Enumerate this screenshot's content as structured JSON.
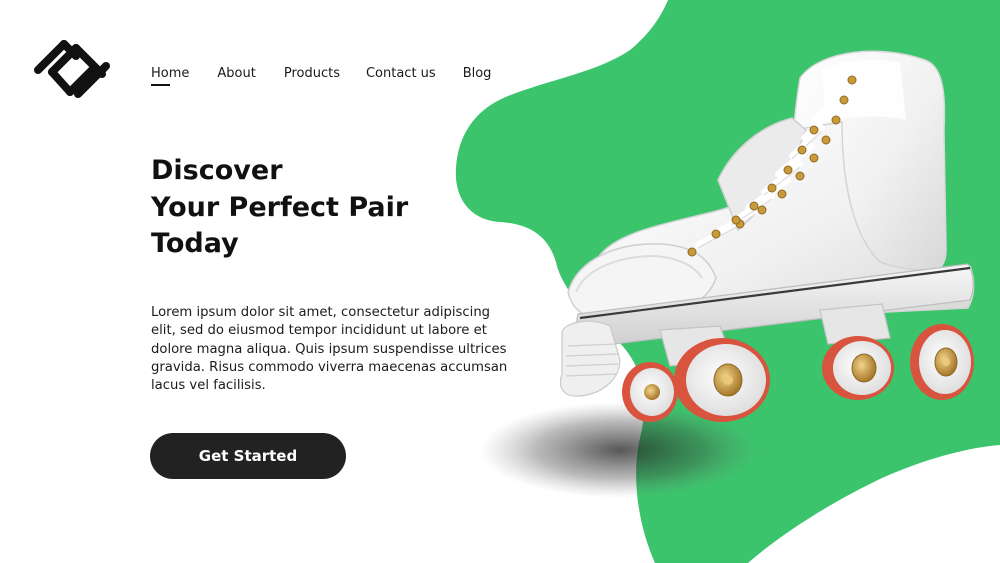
{
  "brand": {
    "logo_icon": "diamond-lattice-logo-icon",
    "logo_color": "#111111"
  },
  "nav": {
    "items": [
      {
        "label": "Home",
        "active": true
      },
      {
        "label": "About",
        "active": false
      },
      {
        "label": "Products",
        "active": false
      },
      {
        "label": "Contact us",
        "active": false
      },
      {
        "label": "Blog",
        "active": false
      }
    ]
  },
  "hero": {
    "headline_lines": [
      "Discover",
      "Your Perfect Pair",
      "Today"
    ],
    "body_lines": [
      "Lorem ipsum dolor sit amet, consectetur adipiscing",
      "elit, sed do eiusmod tempor incididunt ut labore et",
      "dolore magna aliqua. Quis ipsum suspendisse ultrices",
      "gravida. Risus commodo viverra maecenas accumsan",
      "lacus vel facilisis."
    ],
    "cta_label": "Get Started",
    "product_image": "white-roller-skate-image"
  },
  "colors": {
    "accent_green": "#3cc46c",
    "button_dark": "#222222",
    "text_dark": "#111111",
    "background": "#ffffff",
    "wheel_red": "#d9543e",
    "wheel_hub_gold": "#c89a3a"
  }
}
